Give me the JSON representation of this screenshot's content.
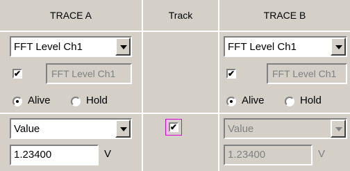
{
  "headers": {
    "trace_a": "TRACE A",
    "track": "Track",
    "trace_b": "TRACE B"
  },
  "trace_a": {
    "function_select": "FFT Level Ch1",
    "label_enabled": true,
    "label_field": "FFT Level Ch1",
    "mode_alive": "Alive",
    "mode_hold": "Hold",
    "selected_mode": "Alive",
    "scale_select": "Value",
    "value": "1.23400",
    "unit": "V"
  },
  "track": {
    "checked": true,
    "check_glyph": "✔"
  },
  "trace_b": {
    "function_select": "FFT Level Ch1",
    "label_enabled": true,
    "label_field": "FFT Level Ch1",
    "mode_alive": "Alive",
    "mode_hold": "Hold",
    "selected_mode": "Alive",
    "scale_select": "Value",
    "value": "1.23400",
    "unit": "V"
  },
  "colors": {
    "panel_bg": "#d4d0c8",
    "separator": "#ffffff",
    "focus_border": "#e000e0",
    "disabled_text": "#808080"
  }
}
